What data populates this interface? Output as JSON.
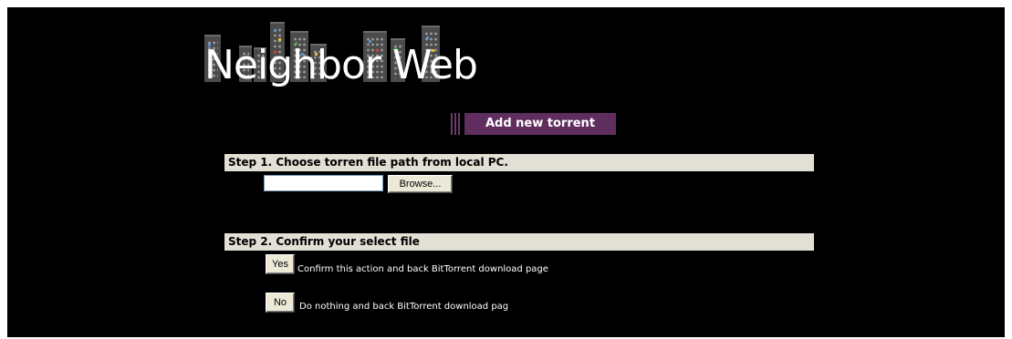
{
  "logo": {
    "text": "Neighbor Web",
    "icon": "city-skyline-icon"
  },
  "header": {
    "button_label": "Add new torrent",
    "accent_color": "#5f2e5f"
  },
  "step1": {
    "title": "Step 1. Choose torren file path from local PC.",
    "file_value": "",
    "browse_label": "Browse..."
  },
  "step2": {
    "title": "Step 2. Confirm your select file",
    "yes_label": "Yes",
    "yes_desc": "Confirm this action and back BitTorrent download page",
    "no_label": "No",
    "no_desc": "Do nothing and back BitTorrent download pag"
  },
  "colors": {
    "background": "#000000",
    "step_bar": "#e2dfd5"
  }
}
